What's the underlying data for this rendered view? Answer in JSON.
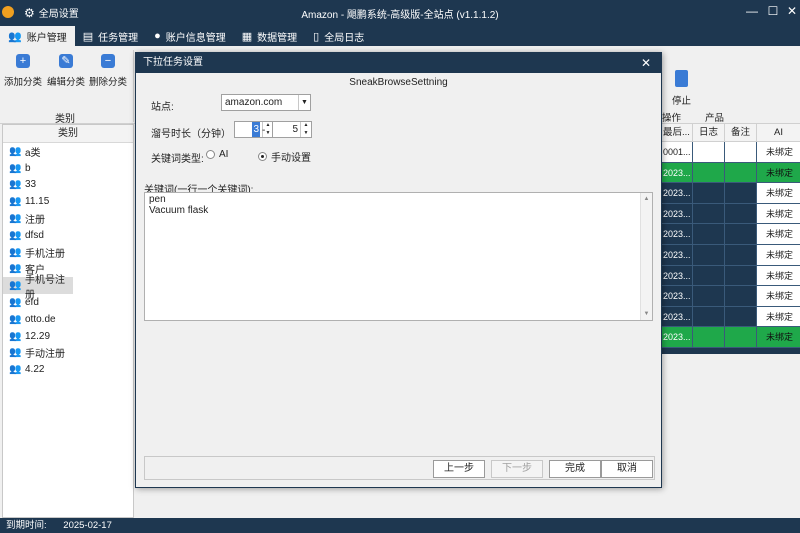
{
  "titlebar": {
    "settings_label": "全局设置",
    "title": "Amazon - 飓鹏系统-高级版-全站点 (v1.1.1.2)"
  },
  "tabs": [
    {
      "label": "账户管理",
      "icon": "users-icon"
    },
    {
      "label": "任务管理",
      "icon": "book-icon"
    },
    {
      "label": "账户信息管理",
      "icon": "user-icon"
    },
    {
      "label": "数据管理",
      "icon": "grid-icon"
    },
    {
      "label": "全局日志",
      "icon": "document-icon"
    }
  ],
  "ribbon": {
    "add_label": "添加分类",
    "edit_label": "编辑分类",
    "delete_label": "删除分类",
    "group_label": "类别",
    "stop_label": "停止",
    "op_label": "操作",
    "product_label": "产品"
  },
  "left_panel": {
    "header": "类别",
    "items": [
      "a类",
      "b",
      "33",
      "11.15",
      "注册",
      "dfsd",
      "手机注册",
      "客户",
      "手机号注册",
      "efd",
      "otto.de",
      "12.29",
      "手动注册",
      "4.22"
    ],
    "selected_index": 8
  },
  "right_table": {
    "headers": [
      "最后...",
      "日志",
      "备注",
      "AI"
    ],
    "rows": [
      {
        "c1": "0001...",
        "ai": "未绑定",
        "style": "white"
      },
      {
        "c1": "2023...",
        "ai": "未绑定",
        "style": "green"
      },
      {
        "c1": "2023...",
        "ai": "未绑定",
        "style": "dark"
      },
      {
        "c1": "2023...",
        "ai": "未绑定",
        "style": "dark"
      },
      {
        "c1": "2023...",
        "ai": "未绑定",
        "style": "dark"
      },
      {
        "c1": "2023...",
        "ai": "未绑定",
        "style": "dark"
      },
      {
        "c1": "2023...",
        "ai": "未绑定",
        "style": "dark"
      },
      {
        "c1": "2023...",
        "ai": "未绑定",
        "style": "dark"
      },
      {
        "c1": "2023...",
        "ai": "未绑定",
        "style": "dark"
      },
      {
        "c1": "2023...",
        "ai": "未绑定",
        "style": "green"
      }
    ]
  },
  "status": {
    "expiry_label": "到期时间:",
    "expiry_value": "2025-02-17"
  },
  "dialog": {
    "title": "下拉任务设置",
    "subtitle": "SneakBrowseSettning",
    "site_label": "站点:",
    "site_value": "amazon.com",
    "duration_label": "溜号时长（分钟）",
    "duration_min": "3",
    "duration_dash": "-",
    "duration_max": "5",
    "keyword_type_label": "关键词类型:",
    "radio_ai": "AI",
    "radio_manual": "手动设置",
    "radio_selected": "manual",
    "keywords_label": "关键词(一行一个关键词):",
    "keywords": [
      "pen",
      "Vacuum flask"
    ],
    "buttons": {
      "prev": "上一步",
      "next": "下一步",
      "finish": "完成",
      "cancel": "取消"
    }
  }
}
